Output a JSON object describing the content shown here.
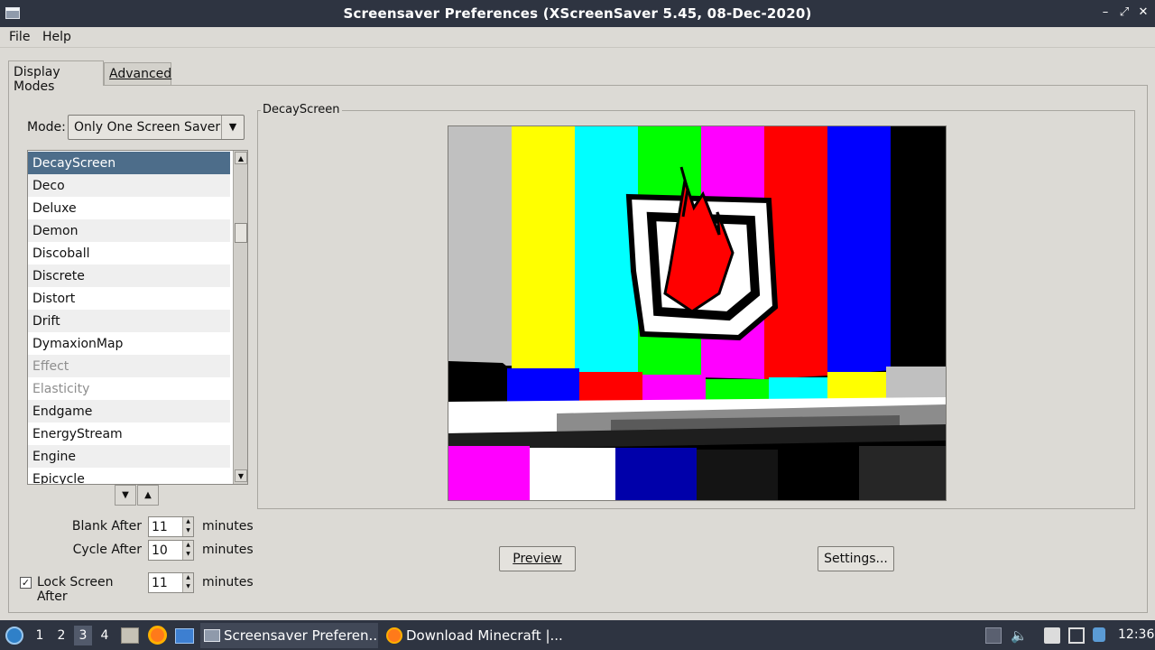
{
  "window": {
    "title": "Screensaver Preferences  (XScreenSaver 5.45, 08-Dec-2020)",
    "controls": [
      "–",
      "⤢",
      "✕"
    ]
  },
  "menu": {
    "file": "File",
    "help": "Help"
  },
  "tabs": {
    "display_modes": "Display Modes",
    "advanced": "Advanced"
  },
  "mode": {
    "label": "Mode:",
    "value": "Only One Screen Saver"
  },
  "screensaver_list": [
    {
      "name": "DecayScreen",
      "state": "selected"
    },
    {
      "name": "Deco",
      "state": "normal"
    },
    {
      "name": "Deluxe",
      "state": "normal"
    },
    {
      "name": "Demon",
      "state": "normal"
    },
    {
      "name": "Discoball",
      "state": "normal"
    },
    {
      "name": "Discrete",
      "state": "normal"
    },
    {
      "name": "Distort",
      "state": "normal"
    },
    {
      "name": "Drift",
      "state": "normal"
    },
    {
      "name": "DymaxionMap",
      "state": "normal"
    },
    {
      "name": "Effect",
      "state": "disabled"
    },
    {
      "name": "Elasticity",
      "state": "disabled"
    },
    {
      "name": "Endgame",
      "state": "normal"
    },
    {
      "name": "EnergyStream",
      "state": "normal"
    },
    {
      "name": "Engine",
      "state": "normal"
    },
    {
      "name": "Epicycle",
      "state": "normal"
    }
  ],
  "timing": {
    "blank_after": {
      "label": "Blank After",
      "value": "11",
      "unit": "minutes"
    },
    "cycle_after": {
      "label": "Cycle After",
      "value": "10",
      "unit": "minutes"
    },
    "lock_after": {
      "label": "Lock Screen After",
      "value": "11",
      "unit": "minutes",
      "checked": true
    }
  },
  "preview": {
    "frame_title": "DecayScreen",
    "preview_button": "Preview",
    "settings_button": "Settings..."
  },
  "taskbar": {
    "workspaces": [
      "1",
      "2",
      "3",
      "4"
    ],
    "active_workspace": "3",
    "tasks": [
      {
        "label": "Screensaver Preferen...",
        "active": true
      },
      {
        "label": "Download Minecraft |...",
        "active": false
      }
    ],
    "clock": "12:36"
  },
  "colors": {
    "titlebar": "#2e3441",
    "selection": "#4d6d8a",
    "window_bg": "#dcdad5"
  }
}
